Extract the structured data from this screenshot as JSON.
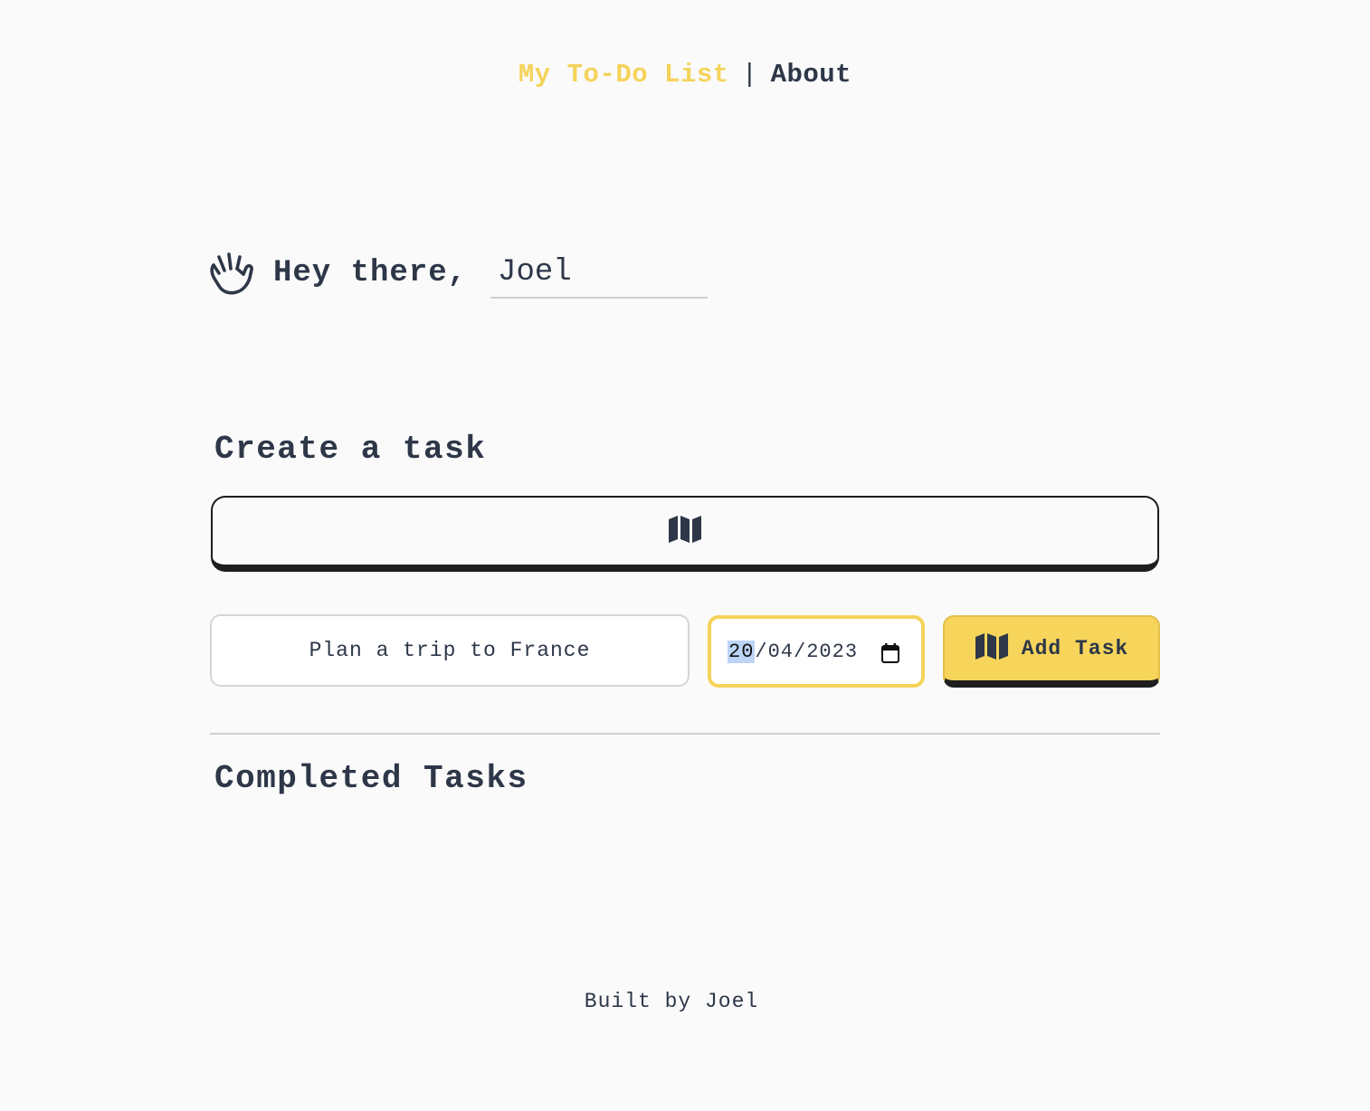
{
  "nav": {
    "brand": "My To-Do List",
    "separator": "|",
    "about": "About"
  },
  "greeting": {
    "icon": "hand-wave-icon",
    "text": "Hey there,",
    "name_value": "Joel"
  },
  "create": {
    "heading": "Create a task",
    "map_icon": "map-icon"
  },
  "form": {
    "task_value": "Plan a trip to France",
    "date": {
      "day": "20",
      "month": "04",
      "year": "2023",
      "icon": "calendar-icon"
    },
    "add_button_label": "Add Task",
    "add_button_icon": "map-icon"
  },
  "completed": {
    "heading": "Completed Tasks",
    "items": []
  },
  "footer": {
    "text": "Built by Joel"
  },
  "colors": {
    "accent": "#f5d35a",
    "text": "#2d3748",
    "background": "#fafafa"
  }
}
